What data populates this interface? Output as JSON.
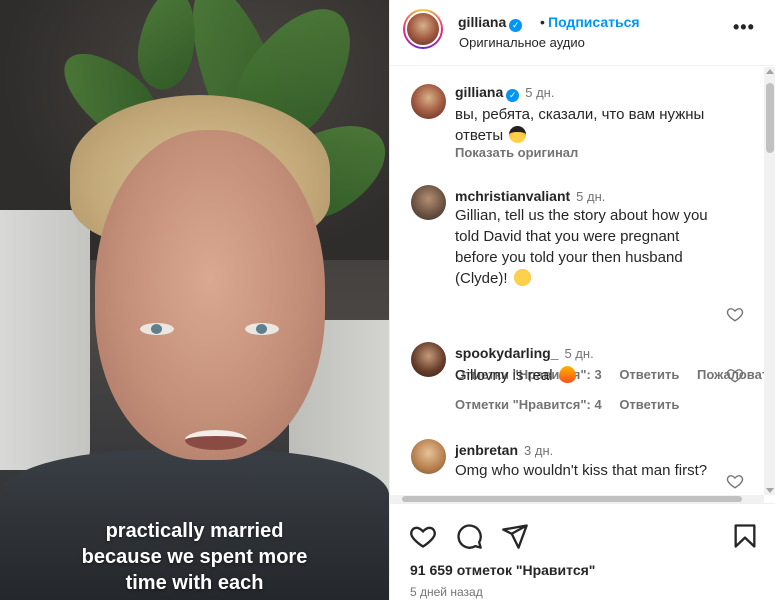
{
  "video": {
    "caption_lines": [
      "practically married",
      "because we spent more",
      "time with each"
    ]
  },
  "header": {
    "username": "gilliana",
    "dot": "•",
    "follow_label": "Подписаться",
    "audio_label": "Оригинальное аудио",
    "more_label": "•••"
  },
  "comments": [
    {
      "username": "gilliana",
      "time": "5 дн.",
      "text": "вы, ребята, сказали, что вам нужны ответы",
      "emoji": "sunglasses-emoji",
      "show_original": "Показать оригинал"
    },
    {
      "username": "mchristianvaliant",
      "time": "5 дн.",
      "text": "Gillian, tell us the story about how you told David that you were pregnant before you told your then husband (Clyde)!",
      "emoji": "wink-emoji",
      "likes_label": "Отметки \"Нравится\": 3",
      "reply_label": "Ответить",
      "report_label": "Пожаловаться"
    },
    {
      "username": "spookydarling_",
      "time": "5 дн.",
      "text": "Gillovny is real",
      "emoji": "fire-emoji",
      "likes_label": "Отметки \"Нравится\": 4",
      "reply_label": "Ответить"
    },
    {
      "username": "jenbretan",
      "time": "3 дн.",
      "text": "Omg who wouldn't kiss that man first?"
    }
  ],
  "footer": {
    "likes_text": "91 659 отметок \"Нравится\"",
    "posted_text": "5 дней назад"
  },
  "icons": [
    "verified-icon",
    "more-icon",
    "heart-icon",
    "comment-icon",
    "share-icon",
    "bookmark-icon"
  ],
  "colors": {
    "accent": "#0095f6",
    "text": "#262626",
    "secondary": "#737373"
  }
}
